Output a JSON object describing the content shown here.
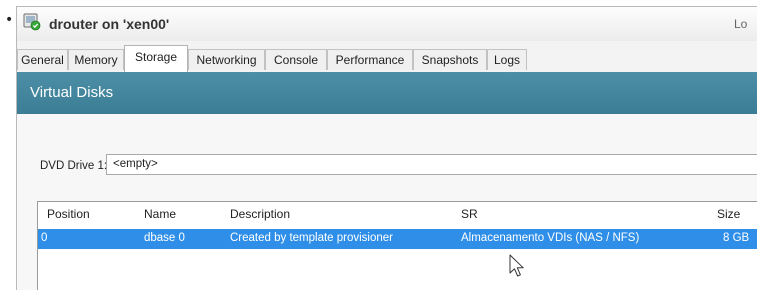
{
  "window": {
    "title": "drouter on 'xen00'",
    "right_text": "Lo",
    "icon": "vm-running-icon"
  },
  "tabs": [
    {
      "label": "General",
      "active": false
    },
    {
      "label": "Memory",
      "active": false
    },
    {
      "label": "Storage",
      "active": true
    },
    {
      "label": "Networking",
      "active": false
    },
    {
      "label": "Console",
      "active": false
    },
    {
      "label": "Performance",
      "active": false
    },
    {
      "label": "Snapshots",
      "active": false
    },
    {
      "label": "Logs",
      "active": false
    }
  ],
  "section": {
    "title": "Virtual Disks"
  },
  "dvd": {
    "label": "DVD Drive 1:",
    "value": "<empty>"
  },
  "table": {
    "columns": [
      "Position",
      "Name",
      "Description",
      "SR",
      "Size"
    ],
    "rows": [
      {
        "position": "0",
        "name": "dbase 0",
        "description": "Created by template provisioner",
        "sr": "Almacenamento VDIs (NAS / NFS)",
        "size": "8 GB",
        "selected": true
      }
    ]
  },
  "colors": {
    "header_bg": "#3b7d95",
    "selection": "#2f8fe8"
  }
}
